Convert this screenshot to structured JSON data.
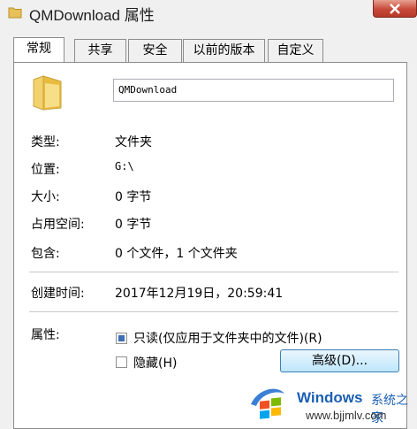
{
  "window": {
    "title": "QMDownload 属性"
  },
  "tabs": [
    {
      "label": "常规"
    },
    {
      "label": "共享"
    },
    {
      "label": "安全"
    },
    {
      "label": "以前的版本"
    },
    {
      "label": "自定义"
    }
  ],
  "general": {
    "name_value": "QMDownload",
    "type_label": "类型:",
    "type_value": "文件夹",
    "location_label": "位置:",
    "location_value": "G:\\",
    "size_label": "大小:",
    "size_value": "0 字节",
    "disk_label": "占用空间:",
    "disk_value": "0 字节",
    "contains_label": "包含:",
    "contains_value": "0 个文件，1 个文件夹",
    "created_label": "创建时间:",
    "created_value": "2017年12月19日，20:59:41",
    "attributes_label": "属性:",
    "readonly_label": "只读(仅应用于文件夹中的文件)(R)",
    "readonly_state": "mixed",
    "hidden_label": "隐藏(H)",
    "hidden_state": "unchecked",
    "advanced_label": "高级(D)..."
  },
  "watermark": {
    "brand": "Windows",
    "subtitle": "系统之家",
    "url": "www.bjjmlv.com"
  },
  "colors": {
    "accent": "#3d6fb4",
    "watermark": "#1b5fb4",
    "close": "#c74a3a"
  }
}
